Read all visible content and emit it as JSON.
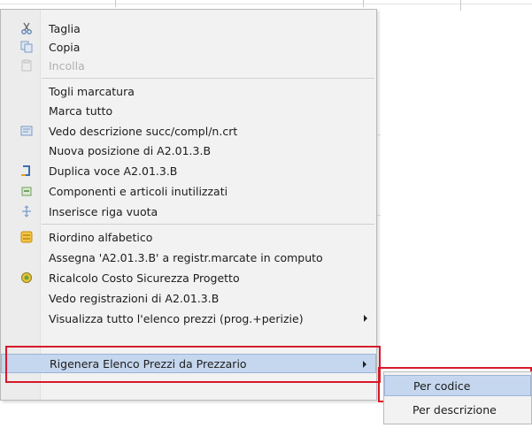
{
  "menu": {
    "items": [
      {
        "label": "Taglia",
        "icon": "scissors-icon",
        "disabled": false
      },
      {
        "label": "Copia",
        "icon": "copy-icon",
        "disabled": false
      },
      {
        "label": "Incolla",
        "icon": "paste-icon",
        "disabled": true
      },
      {
        "label": "Togli marcatura",
        "icon": "",
        "disabled": false
      },
      {
        "label": "Marca tutto",
        "icon": "",
        "disabled": false
      },
      {
        "label": "Vedo descrizione succ/compl/n.crt",
        "icon": "document-view-icon",
        "disabled": false
      },
      {
        "label": "Nuova posizione di  A2.01.3.B",
        "icon": "",
        "disabled": false
      },
      {
        "label": "Duplica voce A2.01.3.B",
        "icon": "duplicate-icon",
        "disabled": false
      },
      {
        "label": "Componenti e articoli inutilizzati",
        "icon": "components-icon",
        "disabled": false
      },
      {
        "label": "Inserisce riga vuota",
        "icon": "insert-row-icon",
        "disabled": false
      },
      {
        "label": "Riordino alfabetico",
        "icon": "sort-icon",
        "disabled": false
      },
      {
        "label": "Assegna 'A2.01.3.B' a registr.marcate in  computo",
        "icon": "",
        "disabled": false
      },
      {
        "label": "Ricalcolo Costo Sicurezza Progetto",
        "icon": "safety-icon",
        "disabled": false
      },
      {
        "label": "Vedo registrazioni di A2.01.3.B",
        "icon": "",
        "disabled": false
      },
      {
        "label": "Visualizza tutto l'elenco prezzi (prog.+perizie)",
        "icon": "",
        "disabled": false,
        "submenu": true
      },
      {
        "label": "Rigenera Elenco Prezzi da Prezzario",
        "icon": "",
        "disabled": false,
        "submenu": true,
        "highlighted": true
      }
    ]
  },
  "submenu": {
    "items": [
      {
        "label": "Per codice",
        "highlighted": true
      },
      {
        "label": "Per descrizione",
        "highlighted": false
      }
    ]
  },
  "colors": {
    "highlight": "#c5d7ee",
    "annotation_red": "#d7192a",
    "menu_bg": "#f2f2f2"
  }
}
